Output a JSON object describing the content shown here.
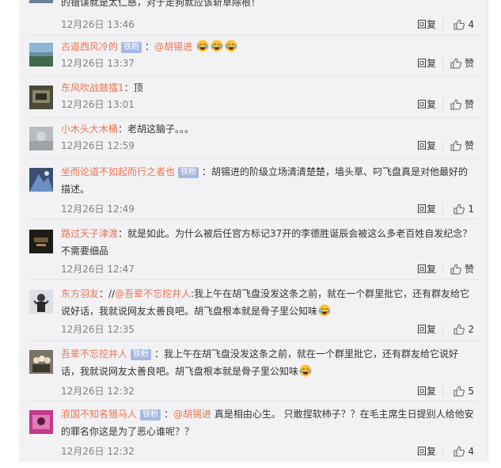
{
  "comments": [
    {
      "nickname": "",
      "badge": "",
      "text": "的错误就是太仁慈，对于走狗就应该斩草除根！",
      "time": "12月26日 13:46",
      "reply": "回复",
      "like": "4"
    },
    {
      "nickname": "古道西风冷的",
      "badge": "铁粉",
      "mention": "@胡锡进",
      "text": "",
      "time": "12月26日 13:37",
      "reply": "回复",
      "like": "赞"
    },
    {
      "nickname": "东风吹战鼓擂1",
      "badge": "",
      "text": "：顶",
      "time": "12月26日 13:01",
      "reply": "回复",
      "like": "赞"
    },
    {
      "nickname": "小木头大木桶",
      "badge": "",
      "text": "：老胡这脑子。。。",
      "time": "12月26日 12:59",
      "reply": "回复",
      "like": "赞"
    },
    {
      "nickname": "坐而论道不如起而行之者也",
      "badge": "铁粉",
      "text": "：胡锡进的阶级立场清清楚楚，墙头草、叼飞盘真是对他最好的",
      "text2": "描述。",
      "time": "12月26日 12:49",
      "reply": "回复",
      "like": "1"
    },
    {
      "nickname": "路过天子津渡",
      "badge": "",
      "text": "：就是如此。为什么被后任官方标记37开的李德胜诞辰会被这么多老百姓自发纪念？",
      "text2": "不需要细品",
      "time": "12月26日 12:47",
      "reply": "回复",
      "like": "赞"
    },
    {
      "nickname": "东方羽友",
      "badge": "",
      "prefix": "：//",
      "mention": "@吾辈不忘挖井人",
      "text": ":我上午在胡飞盘没发这条之前，就在一个群里批它，还有群友给它",
      "text2": "说好话，我就说网友太善良吧。胡飞盘根本就是骨子里公知味",
      "time": "12月26日 12:35",
      "reply": "回复",
      "like": "2"
    },
    {
      "nickname": "吾辈不忘挖井人",
      "badge": "铁粉",
      "text": "：我上午在胡飞盘没发这条之前，就在一个群里批它，还有群友给它说好",
      "text2": "话，我就说网友太善良吧。胡飞盘根本就是骨子里公知味",
      "time": "12月26日 12:32",
      "reply": "回复",
      "like": "5"
    },
    {
      "nickname": "浪国不知名猎马人",
      "badge": "铁粉",
      "prefix": "：",
      "mention": "@胡锡进",
      "text": " 真是相由心生。 只敢捏软柿子？？在毛主席生日提别人给他安",
      "text2": "的罪名你这是为了恶心谁呢？？",
      "time": "12月26日 12:32",
      "reply": "回复",
      "like": "4"
    }
  ]
}
